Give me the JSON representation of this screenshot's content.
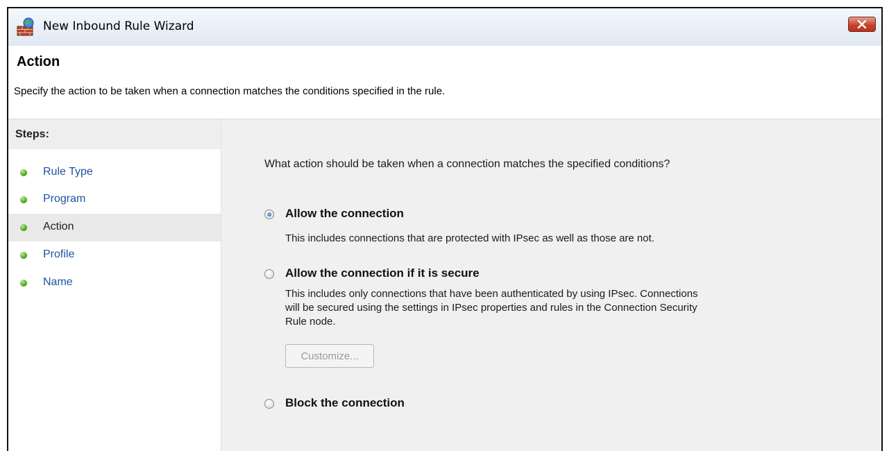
{
  "window": {
    "title": "New Inbound Rule Wizard",
    "close_label": "×"
  },
  "header": {
    "title": "Action",
    "description": "Specify the action to be taken when a connection matches the conditions specified in the rule."
  },
  "sidebar": {
    "steps_title": "Steps:",
    "items": [
      {
        "label": "Rule Type",
        "active": false
      },
      {
        "label": "Program",
        "active": false
      },
      {
        "label": "Action",
        "active": true
      },
      {
        "label": "Profile",
        "active": false
      },
      {
        "label": "Name",
        "active": false
      }
    ]
  },
  "main": {
    "question": "What action should be taken when a connection matches the specified conditions?",
    "options": [
      {
        "label": "Allow the connection",
        "description_lines": [
          "This includes connections that are protected with IPsec as well as those are not."
        ],
        "checked": true
      },
      {
        "label": "Allow the connection if it is secure",
        "description_lines": [
          "This includes only connections that have been authenticated by using IPsec.  Connections",
          "will be secured using the settings in IPsec properties and rules in the Connection Security",
          "Rule node."
        ],
        "checked": false
      },
      {
        "label": "Block the connection",
        "description_lines": [],
        "checked": false
      }
    ],
    "customize_button": "Customize..."
  }
}
